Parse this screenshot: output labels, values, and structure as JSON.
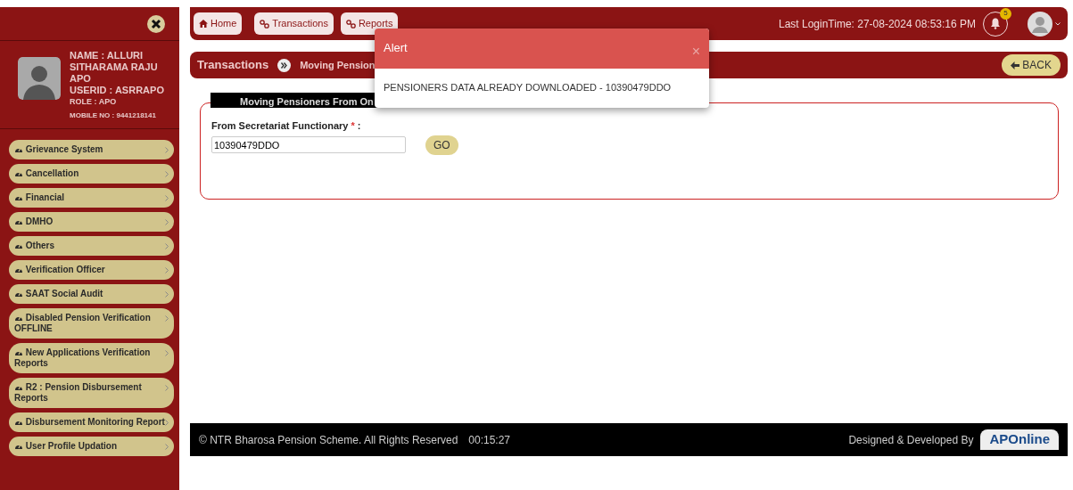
{
  "sidebar": {
    "profile": {
      "name": "NAME : ALLURI SITHARAMA RAJU APO",
      "userid": "USERID : ASRRAPO",
      "role": "ROLE : APO",
      "mobile": "MOBILE NO : 9441218141"
    },
    "menu": [
      {
        "label": "Grievance System"
      },
      {
        "label": "Cancellation"
      },
      {
        "label": "Financial"
      },
      {
        "label": "DMHO"
      },
      {
        "label": "Others"
      },
      {
        "label": "Verification Officer"
      },
      {
        "label": "SAAT Social Audit"
      },
      {
        "label": "Disabled Pension Verification OFFLINE"
      },
      {
        "label": "New Applications Verification Reports"
      },
      {
        "label": "R2 : Pension Disbursement Reports"
      },
      {
        "label": "Disbursement Monitoring Report"
      },
      {
        "label": "User Profile Updation"
      }
    ]
  },
  "topbar": {
    "nav": [
      {
        "label": "Home",
        "kind": "home"
      },
      {
        "label": "Transactions",
        "kind": "link"
      },
      {
        "label": "Reports",
        "kind": "link"
      }
    ],
    "last_login": "Last LoginTime:  27-08-2024 08:53:16 PM",
    "notification_count": "5"
  },
  "breadcrumb": {
    "items": [
      "Transactions",
      "Moving Pension"
    ],
    "back": "BACK"
  },
  "panel": {
    "title": "Moving Pensioners From On",
    "field": {
      "label": "From Secretariat Functionary",
      "required": "*",
      "colon": ":",
      "value": "10390479DDO"
    },
    "button": "GO"
  },
  "footer": {
    "copyright": "© NTR Bharosa Pension Scheme. All Rights Reserved",
    "timer": "00:15:27",
    "credit": "Designed & Developed By",
    "logo": "APOnline"
  },
  "modal": {
    "title": "Alert",
    "close": "×",
    "message": "PENSIONERS DATA ALREADY DOWNLOADED - 10390479DDO"
  }
}
